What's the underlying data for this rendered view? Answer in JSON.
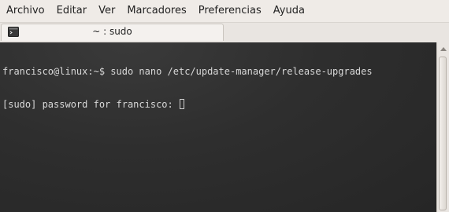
{
  "menu": {
    "items": [
      "Archivo",
      "Editar",
      "Ver",
      "Marcadores",
      "Preferencias",
      "Ayuda"
    ]
  },
  "tab": {
    "icon": "terminal-icon",
    "title": "~ : sudo"
  },
  "terminal": {
    "lines": [
      "francisco@linux:~$ sudo nano /etc/update-manager/release-upgrades",
      "[sudo] password for francisco: "
    ]
  },
  "colors": {
    "window_bg": "#efebe7",
    "terminal_bg": "#2e2e2e",
    "terminal_text": "#d8d8d8"
  }
}
